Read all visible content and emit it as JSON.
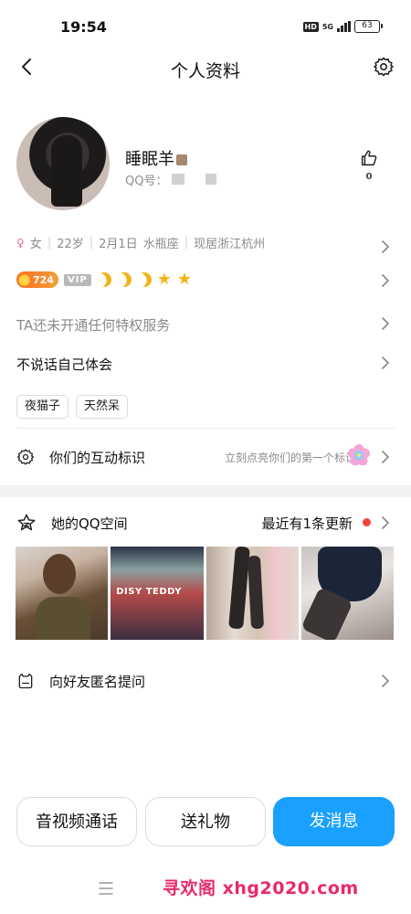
{
  "status_bar": {
    "time": "19:54",
    "hd_label": "HD",
    "network_label": "5G",
    "battery_level": "63"
  },
  "nav": {
    "title": "个人资料",
    "back_icon": "chevron-left-icon",
    "settings_icon": "gear-icon"
  },
  "profile": {
    "nickname": "睡眠羊",
    "qq_label": "QQ号：",
    "like_count": "0"
  },
  "basic_info": {
    "gender": "女",
    "age": "22岁",
    "birthday": "2月1日",
    "zodiac": "水瓶座",
    "location": "现居浙江杭州"
  },
  "badges": {
    "level_number": "724",
    "vip_label": "VIP",
    "moons": 3,
    "stars": 2,
    "accent_color": "#f3b418"
  },
  "privilege_text": "TA还未开通任何特权服务",
  "signature": "不说话自己体会",
  "tags": [
    "夜猫子",
    "天然呆"
  ],
  "interaction": {
    "label": "你们的互动标识",
    "hint": "立刻点亮你们的第一个标识"
  },
  "qzone": {
    "label": "她的QQ空间",
    "update_text": "最近有1条更新",
    "photo_caption": "DISY TEDDY"
  },
  "anon_question": {
    "label": "向好友匿名提问"
  },
  "actions": {
    "call": "音视频通话",
    "gift": "送礼物",
    "message": "发消息",
    "message_color": "#1aa0ff"
  },
  "watermark": "寻欢阁 xhg2020.com"
}
